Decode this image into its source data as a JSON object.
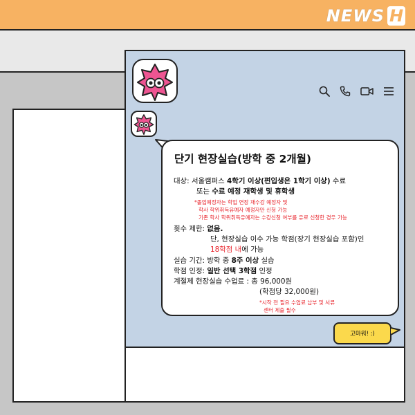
{
  "brand": {
    "text": "NEWS",
    "letter": "H"
  },
  "colors": {
    "accent_orange": "#f7b262",
    "screen_blue": "#c3d3e5",
    "avatar_pink": "#ee5592",
    "reply_yellow": "#fbd94c",
    "note_red": "#e8232b"
  },
  "header_icons": [
    "search-icon",
    "phone-icon",
    "video-icon",
    "menu-icon"
  ],
  "message": {
    "title": "단기 현장실습(방학 중 2개월)",
    "target_label": "대상: ",
    "target_1": "서울캠퍼스 ",
    "target_2": "4학기 이상(편입생은 1학기 이상)",
    "target_3": " 수료",
    "target_4": "또는 ",
    "target_5": "수료 예정 재학생 및 휴학생",
    "note_1": "*졸업예정자는 학업 연장 재수강 예정자 및",
    "note_2": "학사 학위취득유예자 예정자만 신청 가능",
    "note_3": "기존 학사 학위취득유예자는 수강신청 여부를 유로 신청한 경우 가능",
    "limit_label": "횟수 제한: ",
    "limit_value": "없음.",
    "limit_2": "단, 현장실습 이수 가능 학점(장기 현장실습 포함)인",
    "limit_3a": "18학점 내",
    "limit_3b": "에 가능",
    "period_label": "실습 기간: 방학 중 ",
    "period_value": "8주 이상",
    "period_suffix": " 실습",
    "credit_label": "학점 인정: ",
    "credit_value": "일반 선택 3학점",
    "credit_suffix": " 인정",
    "fee_1": "계절제 현장실습 수업료 : 총 96,000원",
    "fee_2": "(학점당 32,000원)",
    "fee_note_1": "*시작 전 필요 수업료 납부 및 서류",
    "fee_note_2": "센터 제출 필수"
  },
  "reply": {
    "text": "고마워! :)"
  }
}
